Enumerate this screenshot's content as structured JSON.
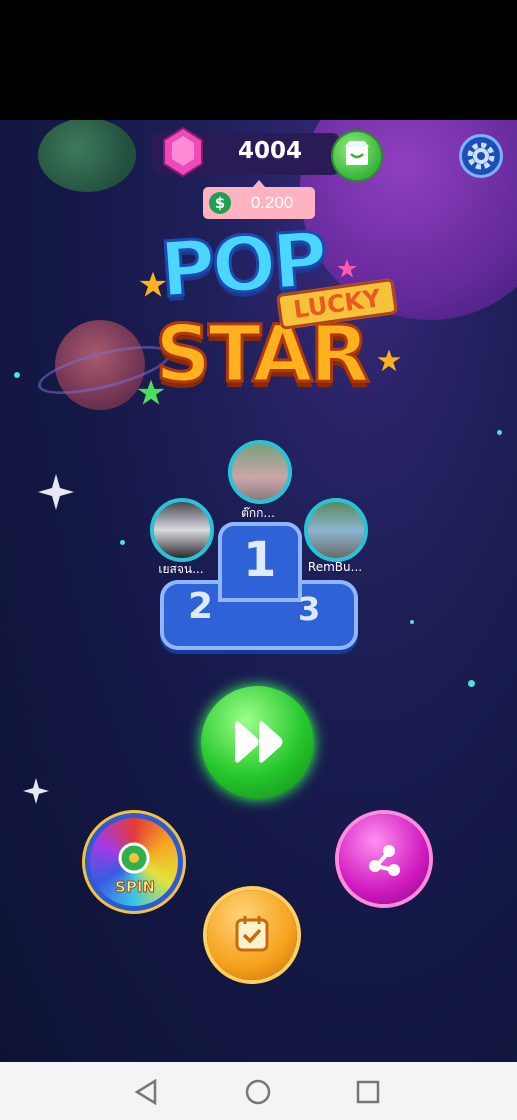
{
  "header": {
    "gem_count": "4004",
    "cash_amount": "0.200",
    "cash_symbol": "$"
  },
  "icons": {
    "gem": "gem-icon",
    "shop": "shop-icon",
    "settings": "gear-icon",
    "play": "fast-forward-icon",
    "share": "share-icon",
    "daily": "calendar-check-icon"
  },
  "logo": {
    "line1": "POP",
    "badge": "LUCKY",
    "line2": "STAR"
  },
  "leaderboard": {
    "first": {
      "rank": "1",
      "name": "ต๊กก..."
    },
    "second": {
      "rank": "2",
      "name": "เยสจน..."
    },
    "third": {
      "rank": "3",
      "name": "RemBu..."
    }
  },
  "buttons": {
    "spin_label": "SPIN"
  },
  "colors": {
    "background": "#141845",
    "gem_bar": "#2a1a55",
    "cash_pill": "#ffb3c0",
    "podium": "#2f62d6",
    "play_button": "#25c72b",
    "share_button": "#d01ac0",
    "daily_button": "#f5a11c"
  }
}
